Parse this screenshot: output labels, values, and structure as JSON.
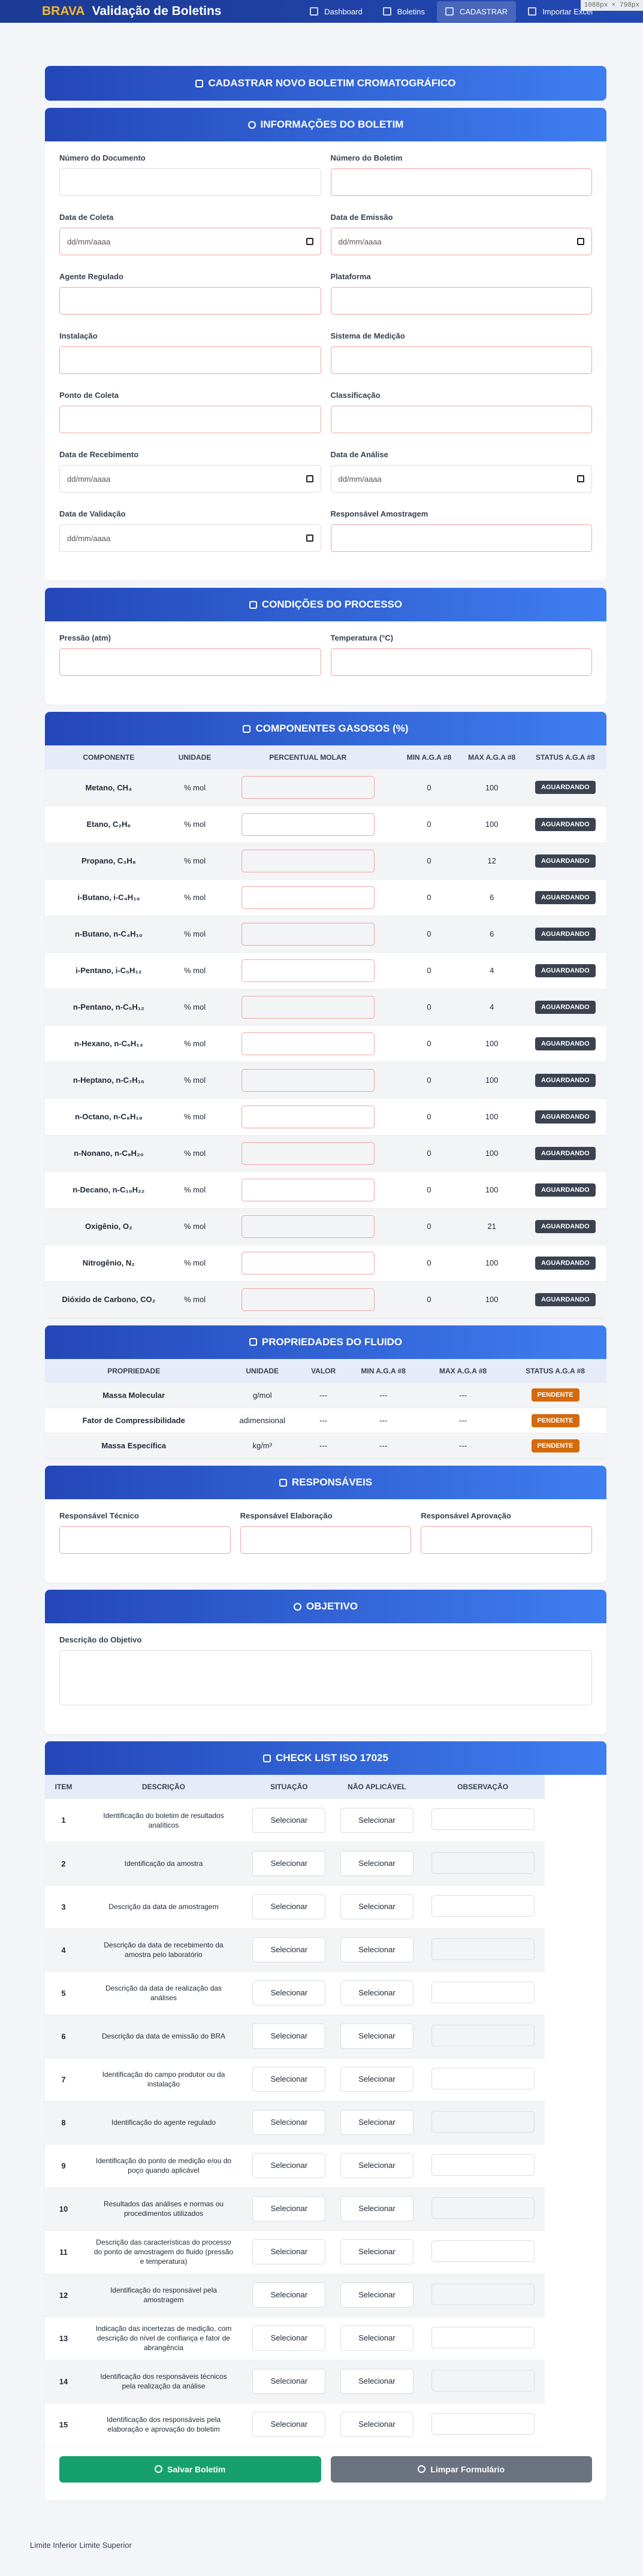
{
  "corner_label": "1088px × 798px",
  "header": {
    "brand": "BRAVA",
    "title": "Validação de Boletins",
    "nav": [
      {
        "label": "Dashboard",
        "icon": "dashboard-icon"
      },
      {
        "label": "Boletins",
        "icon": "document-icon"
      },
      {
        "label": "CADASTRAR",
        "icon": "plus-icon"
      },
      {
        "label": "Importar Excel",
        "icon": "excel-icon"
      }
    ]
  },
  "main_title": "CADASTRAR NOVO BOLETIM CROMATOGRÁFICO",
  "info": {
    "title": "INFORMAÇÕES DO BOLETIM",
    "date_placeholder": "dd/mm/aaaa",
    "fields": [
      "Número do Documento",
      "Número do Boletim",
      "Data de Coleta",
      "Data de Emissão",
      "Agente Regulado",
      "Plataforma",
      "Instalação",
      "Sistema de Medição",
      "Ponto de Coleta",
      "Classificação",
      "Data de Recebimento",
      "Data de Análise",
      "Data de Validação",
      "Responsável Amostragem"
    ]
  },
  "process": {
    "title": "CONDIÇÕES DO PROCESSO",
    "fields": [
      "Pressão (atm)",
      "Temperatura (°C)"
    ]
  },
  "components": {
    "title": "COMPONENTES GASOSOS (%)",
    "headers": [
      "COMPONENTE",
      "UNIDADE",
      "PERCENTUAL MOLAR",
      "MIN A.G.A #8",
      "MAX A.G.A #8",
      "STATUS A.G.A #8"
    ],
    "rows": [
      {
        "name": "Metano, CH₄",
        "unit": "% mol",
        "min": "0",
        "max": "100",
        "status": "AGUARDANDO"
      },
      {
        "name": "Etano, C₂H₆",
        "unit": "% mol",
        "min": "0",
        "max": "100",
        "status": "AGUARDANDO"
      },
      {
        "name": "Propano, C₃H₈",
        "unit": "% mol",
        "min": "0",
        "max": "12",
        "status": "AGUARDANDO"
      },
      {
        "name": "i-Butano, i-C₄H₁₀",
        "unit": "% mol",
        "min": "0",
        "max": "6",
        "status": "AGUARDANDO"
      },
      {
        "name": "n-Butano, n-C₄H₁₀",
        "unit": "% mol",
        "min": "0",
        "max": "6",
        "status": "AGUARDANDO"
      },
      {
        "name": "i-Pentano, i-C₅H₁₂",
        "unit": "% mol",
        "min": "0",
        "max": "4",
        "status": "AGUARDANDO"
      },
      {
        "name": "n-Pentano, n-C₅H₁₂",
        "unit": "% mol",
        "min": "0",
        "max": "4",
        "status": "AGUARDANDO"
      },
      {
        "name": "n-Hexano, n-C₆H₁₄",
        "unit": "% mol",
        "min": "0",
        "max": "100",
        "status": "AGUARDANDO"
      },
      {
        "name": "n-Heptano, n-C₇H₁₆",
        "unit": "% mol",
        "min": "0",
        "max": "100",
        "status": "AGUARDANDO"
      },
      {
        "name": "n-Octano, n-C₈H₁₈",
        "unit": "% mol",
        "min": "0",
        "max": "100",
        "status": "AGUARDANDO"
      },
      {
        "name": "n-Nonano, n-C₉H₂₀",
        "unit": "% mol",
        "min": "0",
        "max": "100",
        "status": "AGUARDANDO"
      },
      {
        "name": "n-Decano, n-C₁₀H₂₂",
        "unit": "% mol",
        "min": "0",
        "max": "100",
        "status": "AGUARDANDO"
      },
      {
        "name": "Oxigênio, O₂",
        "unit": "% mol",
        "min": "0",
        "max": "21",
        "status": "AGUARDANDO"
      },
      {
        "name": "Nitrogênio, N₂",
        "unit": "% mol",
        "min": "0",
        "max": "100",
        "status": "AGUARDANDO"
      },
      {
        "name": "Dióxido de Carbono, CO₂",
        "unit": "% mol",
        "min": "0",
        "max": "100",
        "status": "AGUARDANDO"
      }
    ]
  },
  "fluid": {
    "title": "PROPRIEDADES DO FLUIDO",
    "headers": [
      "PROPRIEDADE",
      "UNIDADE",
      "VALOR",
      "MIN A.G.A #8",
      "MAX A.G.A #8",
      "STATUS A.G.A #8"
    ],
    "rows": [
      {
        "name": "Massa Molecular",
        "unit": "g/mol",
        "value": "---",
        "min": "---",
        "max": "---",
        "status": "PENDENTE"
      },
      {
        "name": "Fator de Compressibilidade",
        "unit": "adimensional",
        "value": "---",
        "min": "---",
        "max": "---",
        "status": "PENDENTE"
      },
      {
        "name": "Massa Específica",
        "unit": "kg/m³",
        "value": "---",
        "min": "---",
        "max": "---",
        "status": "PENDENTE"
      }
    ]
  },
  "responsaveis": {
    "title": "RESPONSÁVEIS",
    "fields": [
      "Responsável Técnico",
      "Responsável Elaboração",
      "Responsável Aprovação"
    ]
  },
  "objetivo": {
    "title": "OBJETIVO",
    "label": "Descrição do Objetivo"
  },
  "checklist": {
    "title": "CHECK LIST ISO 17025",
    "headers": [
      "ITEM",
      "DESCRIÇÃO",
      "SITUAÇÃO",
      "NÃO APLICÁVEL",
      "OBSERVAÇÃO"
    ],
    "select_label": "Selecionar",
    "rows": [
      {
        "item": "1",
        "desc": "Identificação do boletim de resultados analíticos"
      },
      {
        "item": "2",
        "desc": "Identificação da amostra"
      },
      {
        "item": "3",
        "desc": "Descrição da data de amostragem"
      },
      {
        "item": "4",
        "desc": "Descrição da data de recebimento da amostra pelo laboratório"
      },
      {
        "item": "5",
        "desc": "Descrição da data de realização das análises"
      },
      {
        "item": "6",
        "desc": "Descrição da data de emissão do BRA"
      },
      {
        "item": "7",
        "desc": "Identificação do campo produtor ou da instalação"
      },
      {
        "item": "8",
        "desc": "Identificação do agente regulado"
      },
      {
        "item": "9",
        "desc": "Identificação do ponto de medição e/ou do poço quando aplicável"
      },
      {
        "item": "10",
        "desc": "Resultados das análises e normas ou procedimentos utilizados"
      },
      {
        "item": "11",
        "desc": "Descrição das características do processo do ponto de amostragem do fluido (pressão e temperatura)"
      },
      {
        "item": "12",
        "desc": "Identificação do responsável pela amostragem"
      },
      {
        "item": "13",
        "desc": "Indicação das incertezas de medição, com descrição do nível de confiança e fator de abrangência"
      },
      {
        "item": "14",
        "desc": "Identificação dos responsáveis técnicos pela realização da análise"
      },
      {
        "item": "15",
        "desc": "Identificação dos responsáveis pela elaboração e aprovação do boletim"
      }
    ]
  },
  "actions": {
    "save": "Salvar Boletim",
    "clear": "Limpar Formulário"
  },
  "footer": "Limite Inferior Limite Superior"
}
